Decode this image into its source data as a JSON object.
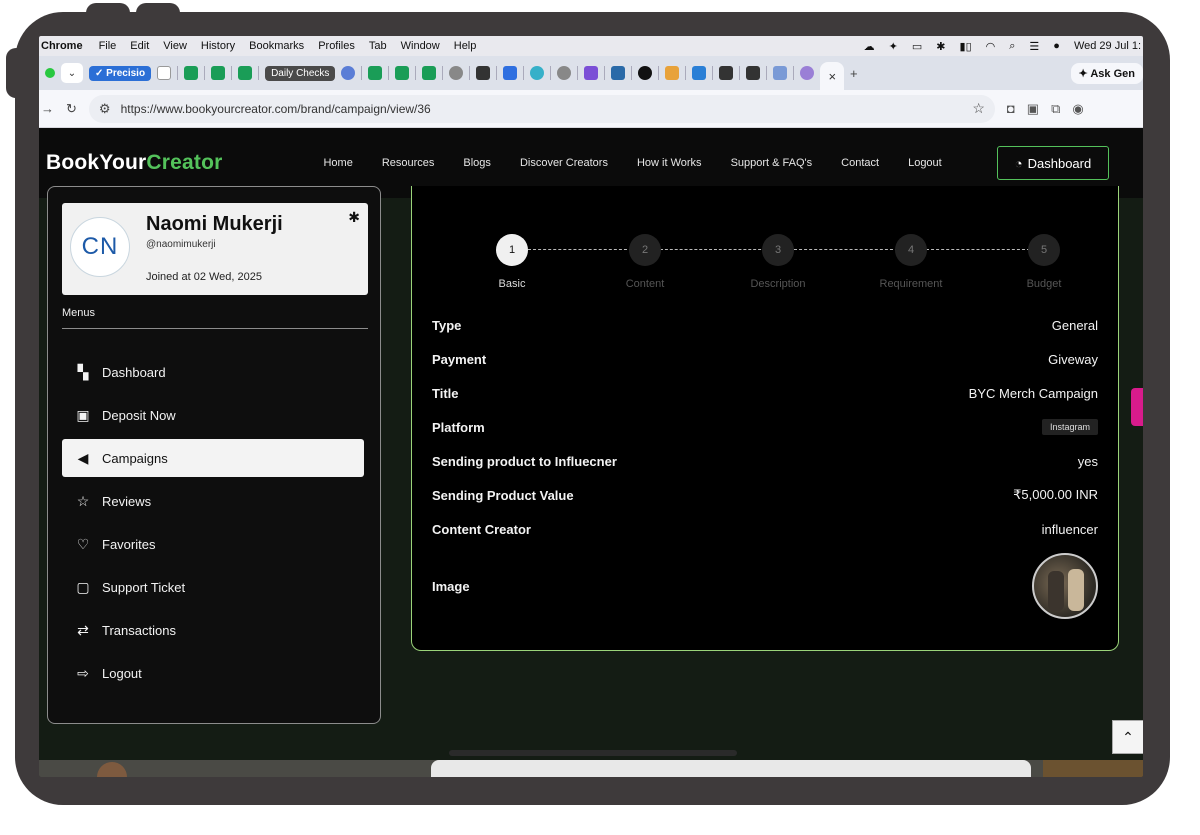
{
  "menubar": {
    "app": "Chrome",
    "items": [
      "File",
      "Edit",
      "View",
      "History",
      "Bookmarks",
      "Profiles",
      "Tab",
      "Window",
      "Help"
    ],
    "clock": "Wed 29 Jul 1:"
  },
  "tabs": {
    "group1": "✓ Precisio",
    "group2": "Daily Checks",
    "ask": "✦ Ask Gen",
    "new_tab": "+",
    "close": "×"
  },
  "address": {
    "url": "https://www.bookyourcreator.com/brand/campaign/view/36"
  },
  "site": {
    "logo_part1": "BookYour",
    "logo_part2": "Creator",
    "nav": [
      "Home",
      "Resources",
      "Blogs",
      "Discover Creators",
      "How it Works",
      "Support & FAQ's",
      "Contact",
      "Logout"
    ],
    "dashboard_button": "Dashboard"
  },
  "profile": {
    "initials": "CN",
    "name": "Naomi Mukerji",
    "handle": "@naomimukerji",
    "joined": "Joined at 02 Wed, 2025"
  },
  "sidebar": {
    "menus_label": "Menus",
    "items": [
      {
        "label": "Dashboard",
        "icon": "dashboard-icon"
      },
      {
        "label": "Deposit Now",
        "icon": "money-icon"
      },
      {
        "label": "Campaigns",
        "icon": "megaphone-icon",
        "active": true
      },
      {
        "label": "Reviews",
        "icon": "star-icon"
      },
      {
        "label": "Favorites",
        "icon": "heart-icon"
      },
      {
        "label": "Support Ticket",
        "icon": "chat-icon"
      },
      {
        "label": "Transactions",
        "icon": "exchange-icon"
      },
      {
        "label": "Logout",
        "icon": "logout-icon"
      }
    ]
  },
  "stepper": [
    {
      "num": "1",
      "label": "Basic",
      "active": true
    },
    {
      "num": "2",
      "label": "Content"
    },
    {
      "num": "3",
      "label": "Description"
    },
    {
      "num": "4",
      "label": "Requirement"
    },
    {
      "num": "5",
      "label": "Budget"
    }
  ],
  "details": {
    "type_key": "Type",
    "type_val": "General",
    "payment_key": "Payment",
    "payment_val": "Giveway",
    "title_key": "Title",
    "title_val": "BYC Merch Campaign",
    "platform_key": "Platform",
    "platform_val": "Instagram",
    "sending_key": "Sending product to Influecner",
    "sending_val": "yes",
    "value_key": "Sending Product Value",
    "value_val": "₹5,000.00 INR",
    "creator_key": "Content Creator",
    "creator_val": "influencer",
    "image_key": "Image"
  },
  "colors": {
    "accent": "#54c25b",
    "panel_border": "#9bd47a",
    "side_tab": "#d81b8c"
  }
}
